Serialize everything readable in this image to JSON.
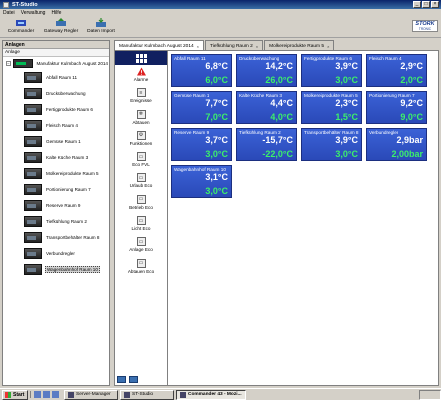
{
  "window": {
    "title": "ST-Studio"
  },
  "menu": [
    "Datei",
    "Verwaltung",
    "Hilfe"
  ],
  "toolbar": [
    {
      "label": "Commander",
      "icon": "commander-icon"
    },
    {
      "label": "Gateway Regler",
      "icon": "gateway-icon"
    },
    {
      "label": "Daten Import",
      "icon": "data-import-icon"
    }
  ],
  "logo": {
    "line1": "STORK",
    "line2": "TRONIC"
  },
  "left": {
    "title": "Anlagen",
    "subtitle": "Anlage",
    "root": "Manufaktur Kulmbach August 2014",
    "items": [
      "Abfall Raum 11",
      "Drucküberwachung",
      "Fertigprodukte Raum 6",
      "Fleisch Raum 4",
      "Gemüse Raum 1",
      "Kalte Küche Raum 3",
      "Molkereiprodukte Raum 5",
      "Portionierung Raum 7",
      "Reserve Raum 9",
      "Tiefkühlung Raum 2",
      "Transportbehälter Raum 8",
      "Verbundregler",
      "Wagenbahnhof Raum 10"
    ]
  },
  "tabs": [
    {
      "label": "Manufaktur Kulmbach August 2014",
      "active": true
    },
    {
      "label": "Tiefkühlung Raum 2",
      "active": false
    },
    {
      "label": "Molkereiprodukte Raum 5",
      "active": false
    }
  ],
  "functions": [
    "Alarme",
    "Ereignisse",
    "Abtauen",
    "Funktionen",
    "Eco FVL",
    "Urlaub Eco",
    "Betrieb Eco",
    "Licht Eco",
    "Anlage Eco",
    "Abtauen Eco"
  ],
  "tiles": [
    {
      "name": "Abfall Raum 11",
      "v1": "6,8°C",
      "v2": "6,0°C"
    },
    {
      "name": "Drucküberwachung",
      "v1": "14,2°C",
      "v2": "26,0°C"
    },
    {
      "name": "Fertigprodukte Raum 6",
      "v1": "3,9°C",
      "v2": "3,0°C"
    },
    {
      "name": "Fleisch Raum 4",
      "v1": "2,9°C",
      "v2": "2,0°C"
    },
    {
      "name": "Gemüse Raum 1",
      "v1": "7,7°C",
      "v2": "7,0°C"
    },
    {
      "name": "Kalte Küche Raum 3",
      "v1": "4,4°C",
      "v2": "4,0°C"
    },
    {
      "name": "Molkereiprodukte Raum 5",
      "v1": "2,3°C",
      "v2": "1,5°C"
    },
    {
      "name": "Portionierung Raum 7",
      "v1": "9,2°C",
      "v2": "9,0°C"
    },
    {
      "name": "Reserve Raum 9",
      "v1": "3,7°C",
      "v2": "3,0°C"
    },
    {
      "name": "Tiefkühlung Raum 2",
      "v1": "-15,7°C",
      "v2": "-22,0°C"
    },
    {
      "name": "Transportbehälter Raum 8",
      "v1": "3,9°C",
      "v2": "3,0°C"
    },
    {
      "name": "Verbundregler",
      "v1": "2,9bar",
      "v2": "2,00bar"
    },
    {
      "name": "Wagenbahnhof Raum 10",
      "v1": "3,1°C",
      "v2": "3,0°C"
    }
  ],
  "taskbar": {
    "start": "Start",
    "tasks": [
      {
        "label": "Server-Manager",
        "active": false
      },
      {
        "label": "ST-Studio",
        "active": false
      },
      {
        "label": "Commander 43 - Mozi...",
        "active": true
      }
    ]
  }
}
